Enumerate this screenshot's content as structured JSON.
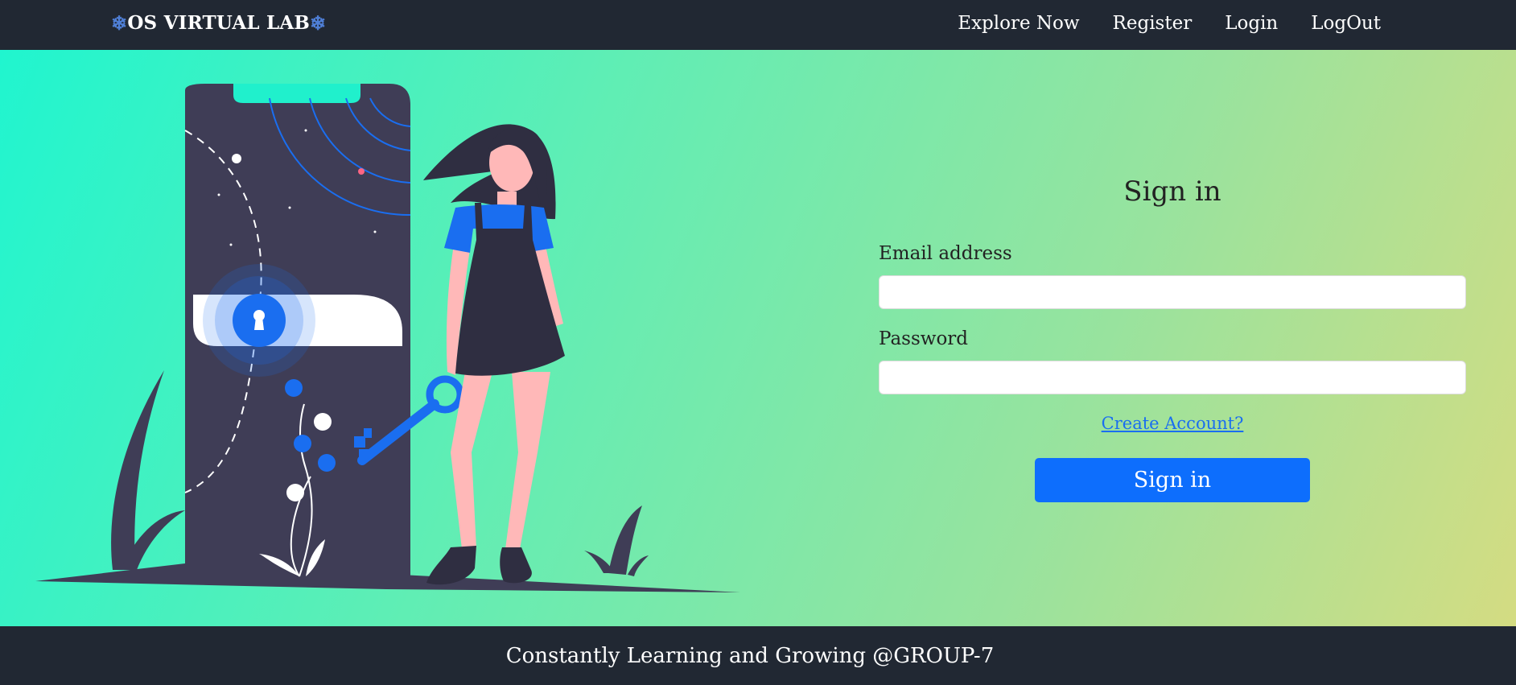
{
  "navbar": {
    "brand": "OS VIRTUAL LAB",
    "brand_icon": "snowflake-icon",
    "links": [
      "Explore Now",
      "Register",
      "Login",
      "LogOut"
    ]
  },
  "signin": {
    "title": "Sign in",
    "email_label": "Email address",
    "email_value": "",
    "password_label": "Password",
    "password_value": "",
    "create_account": "Create Account?",
    "submit_label": "Sign in"
  },
  "footer": {
    "text": "Constantly Learning and Growing @GROUP-7"
  },
  "colors": {
    "navbar_bg": "#212833",
    "primary": "#0d6efd",
    "gradient_start": "#20f5cf",
    "gradient_end": "#d4dc82",
    "illustration_dark": "#3f3d56"
  }
}
